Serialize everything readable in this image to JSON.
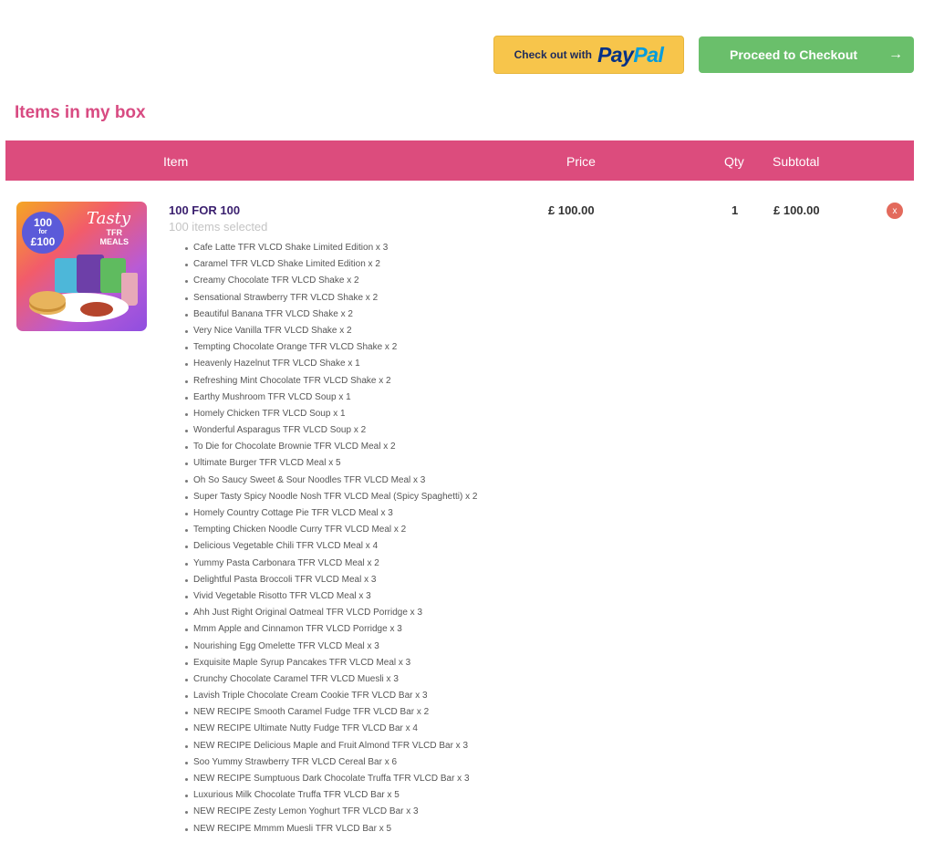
{
  "actions": {
    "paypal_text": "Check out with",
    "paypal_logo_pay": "Pay",
    "paypal_logo_pal": "Pal",
    "checkout_label": "Proceed to Checkout",
    "checkout_arrow": "→"
  },
  "section_title": "Items in my box",
  "table": {
    "headers": {
      "item": "Item",
      "price": "Price",
      "qty": "Qty",
      "subtotal": "Subtotal"
    }
  },
  "product": {
    "image": {
      "badge_line1": "100",
      "badge_line2": "for",
      "badge_line3": "£100",
      "brand": "Tasty",
      "tfr_line1": "TFR",
      "tfr_line2": "MEALS"
    },
    "name": "100 FOR 100",
    "selected": "100 items selected",
    "price": "£ 100.00",
    "qty": "1",
    "subtotal": "£ 100.00",
    "remove": "x",
    "items": [
      "Cafe Latte TFR VLCD Shake Limited Edition x 3",
      "Caramel TFR VLCD Shake Limited Edition x 2",
      "Creamy Chocolate TFR VLCD Shake x 2",
      "Sensational Strawberry TFR VLCD Shake x 2",
      "Beautiful Banana TFR VLCD Shake x 2",
      "Very Nice Vanilla TFR VLCD Shake x 2",
      "Tempting Chocolate Orange TFR VLCD Shake x 2",
      "Heavenly Hazelnut TFR VLCD Shake x 1",
      "Refreshing Mint Chocolate TFR VLCD Shake x 2",
      "Earthy Mushroom TFR VLCD Soup x 1",
      "Homely Chicken TFR VLCD Soup x 1",
      "Wonderful Asparagus TFR VLCD Soup x 2",
      "To Die for Chocolate Brownie TFR VLCD Meal x 2",
      "Ultimate Burger TFR VLCD Meal x 5",
      "Oh So Saucy Sweet & Sour Noodles TFR VLCD Meal x 3",
      "Super Tasty Spicy Noodle Nosh TFR VLCD Meal (Spicy Spaghetti) x 2",
      "Homely Country Cottage Pie TFR VLCD Meal x 3",
      "Tempting Chicken Noodle Curry TFR VLCD Meal x 2",
      "Delicious Vegetable Chili TFR VLCD Meal x 4",
      "Yummy Pasta Carbonara TFR VLCD Meal x 2",
      "Delightful Pasta Broccoli TFR VLCD Meal x 3",
      "Vivid Vegetable Risotto TFR VLCD Meal x 3",
      "Ahh Just Right Original Oatmeal TFR VLCD Porridge x 3",
      "Mmm Apple and Cinnamon TFR VLCD Porridge x 3",
      "Nourishing Egg Omelette TFR VLCD Meal x 3",
      "Exquisite Maple Syrup Pancakes TFR VLCD Meal x 3",
      "Crunchy Chocolate Caramel TFR VLCD Muesli x 3",
      "Lavish Triple Chocolate Cream Cookie TFR VLCD Bar x 3",
      "NEW RECIPE Smooth Caramel Fudge TFR VLCD Bar x 2",
      "NEW RECIPE Ultimate Nutty Fudge TFR VLCD Bar x 4",
      "NEW RECIPE Delicious Maple and Fruit Almond TFR VLCD Bar x 3",
      "Soo Yummy Strawberry TFR VLCD Cereal Bar x 6",
      "NEW RECIPE Sumptuous Dark Chocolate Truffa TFR VLCD Bar x 3",
      "Luxurious Milk Chocolate Truffa TFR VLCD Bar x 5",
      "NEW RECIPE Zesty Lemon Yoghurt TFR VLCD Bar x 3",
      "NEW RECIPE Mmmm Muesli TFR VLCD Bar x 5"
    ]
  },
  "colors": {
    "accent_pink": "#dc4c7d",
    "title_pink": "#d84b82",
    "checkout_green": "#6abf6b",
    "paypal_yellow": "#f7c54b",
    "remove_red": "#e36a5c"
  }
}
